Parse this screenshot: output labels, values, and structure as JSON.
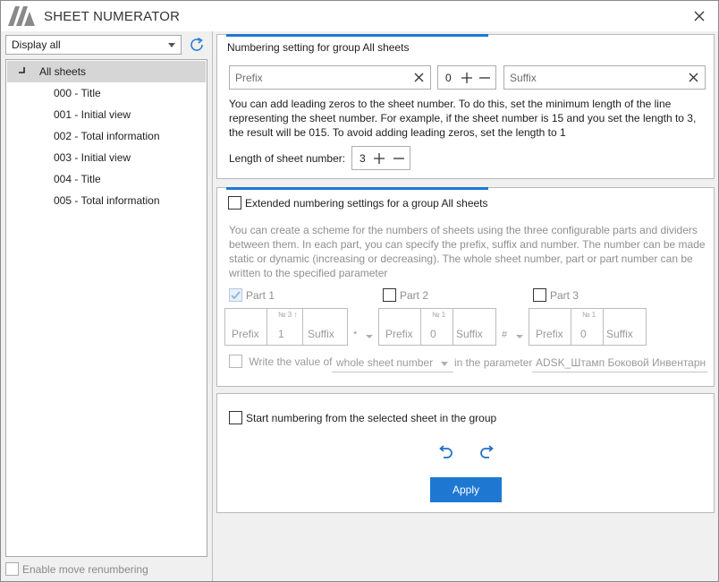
{
  "app": {
    "title": "SHEET NUMERATOR",
    "close_icon": "close-icon",
    "logo_icon": "logo-icon",
    "accent_color": "#1e78d2"
  },
  "left": {
    "display_select": "Display all",
    "refresh_icon": "refresh-icon",
    "tree": {
      "root": "All sheets",
      "items": [
        "000 - Title",
        "001 - Initial view",
        "002 - Total information",
        "003 - Initial view",
        "004 - Title",
        "005 - Total information"
      ]
    },
    "enable_move": "Enable move renumbering"
  },
  "numbering": {
    "title": "Numbering setting for group All sheets",
    "prefix_placeholder": "Prefix",
    "number_value": "0",
    "suffix_placeholder": "Suffix",
    "description_lines": [
      "You can add leading zeros to the sheet number. To do this, set the minimum length of the line",
      "representing the sheet number. For example, if the sheet number is 15 and you set the length to 3,",
      "the result will be 015. To avoid adding leading zeros, set the length to 1"
    ],
    "length_label": "Length of sheet number:",
    "length_value": "3"
  },
  "extended": {
    "title": "Extended numbering settings for a group All sheets",
    "checked": false,
    "description_lines": [
      "You can create a scheme for the numbers of sheets using the three configurable parts and dividers",
      "between them. In each part, you can specify the prefix, suffix and number. The number can be made",
      "static or dynamic (increasing or decreasing). The whole sheet number, part or part number can be",
      "written to the specified parameter"
    ],
    "parts": [
      {
        "label": "Part 1",
        "checked": true,
        "prefix": "Prefix",
        "sup": "№ 3 ↑",
        "number": "1",
        "suffix": "Suffix"
      },
      {
        "label": "Part 2",
        "checked": false,
        "prefix": "Prefix",
        "sup": "№ 1",
        "number": "0",
        "suffix": "Suffix"
      },
      {
        "label": "Part 3",
        "checked": false,
        "prefix": "Prefix",
        "sup": "№ 1",
        "number": "0",
        "suffix": "Suffix"
      }
    ],
    "dividers": [
      "*",
      "#"
    ],
    "write_label": "Write the value of",
    "write_select": "whole sheet number",
    "in_param_label": "in the parameter",
    "param_value": "ADSK_Штамп Боковой Инвентарн"
  },
  "actions": {
    "start_label": "Start numbering from the selected sheet in the group",
    "undo_icon": "undo-icon",
    "redo_icon": "redo-icon",
    "apply_label": "Apply"
  }
}
